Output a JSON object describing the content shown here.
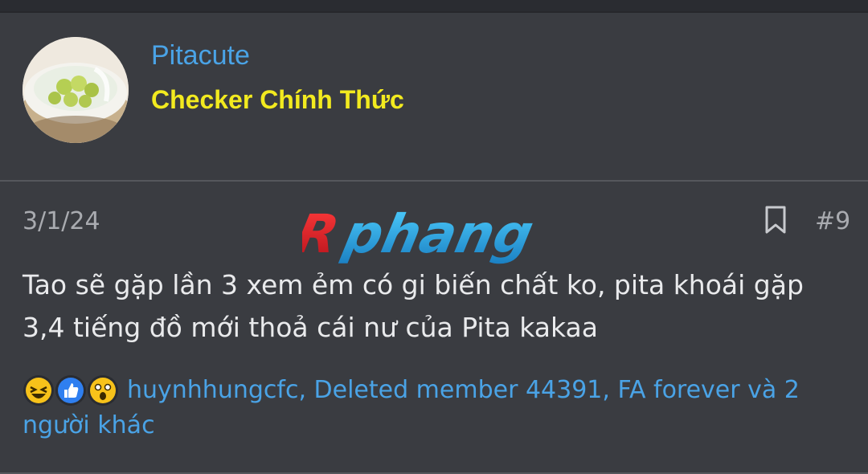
{
  "post": {
    "username": "Pitacute",
    "user_title": "Checker Chính Thức",
    "date": "3/1/24",
    "post_number": "#9",
    "content_line1": "Tao sẽ gặp lần 3 xem ẻm có gi biến chất ko, pita khoái gặp",
    "content_line2": "3,4 tiếng đồ mới thoả cái nư của Pita kakaa",
    "reactions_text": "huynhhungcfc, Deleted member 44391, FA forever và 2 người khác",
    "reaction_icons": [
      "laugh-reaction-icon",
      "like-reaction-icon",
      "wow-reaction-icon"
    ]
  },
  "watermark": {
    "text": "Rphang"
  },
  "colors": {
    "background": "#3a3c41",
    "username": "#4aa3e6",
    "user_title": "#f2ea1f",
    "text": "#e9eaec",
    "muted": "#a9abb0"
  }
}
